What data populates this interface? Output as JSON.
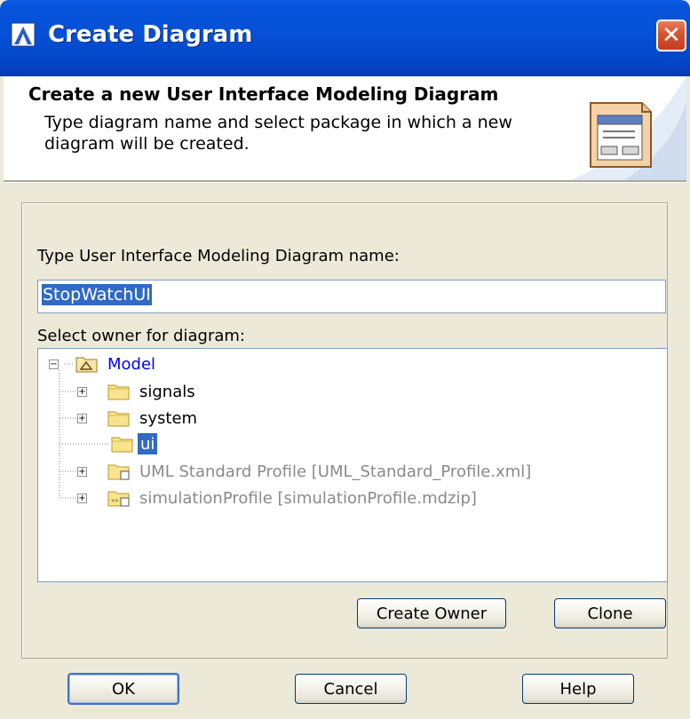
{
  "window": {
    "title": "Create Diagram",
    "close_glyph": "✕"
  },
  "header": {
    "title": "Create a new User Interface Modeling Diagram",
    "description": "Type diagram name and select package in which a new diagram will be created.",
    "icon": "user-interface-diagram-icon"
  },
  "form": {
    "name_label": "Type User Interface Modeling Diagram name:",
    "name_value": "StopWatchUI",
    "owner_label": "Select owner for diagram:"
  },
  "tree": {
    "root": {
      "label": "Model",
      "expander": "−",
      "color": "#0000ff"
    },
    "items": [
      {
        "label": "signals",
        "expander": "+",
        "muted": false,
        "selected": false,
        "icon": "folder-icon"
      },
      {
        "label": "system",
        "expander": "+",
        "muted": false,
        "selected": false,
        "icon": "folder-icon"
      },
      {
        "label": "ui",
        "expander": "",
        "muted": false,
        "selected": true,
        "icon": "folder-icon"
      },
      {
        "label": "UML Standard Profile [UML_Standard_Profile.xml]",
        "expander": "+",
        "muted": true,
        "selected": false,
        "icon": "profile-folder-icon"
      },
      {
        "label": "simulationProfile [simulationProfile.mdzip]",
        "expander": "+",
        "muted": true,
        "selected": false,
        "icon": "profile-package-icon"
      }
    ]
  },
  "buttons": {
    "create_owner": "Create Owner",
    "clone": "Clone",
    "ok": "OK",
    "cancel": "Cancel",
    "help": "Help"
  },
  "colors": {
    "title_bar": "#0553d8",
    "selection": "#316ac5",
    "muted_text": "#8a8a8a"
  }
}
